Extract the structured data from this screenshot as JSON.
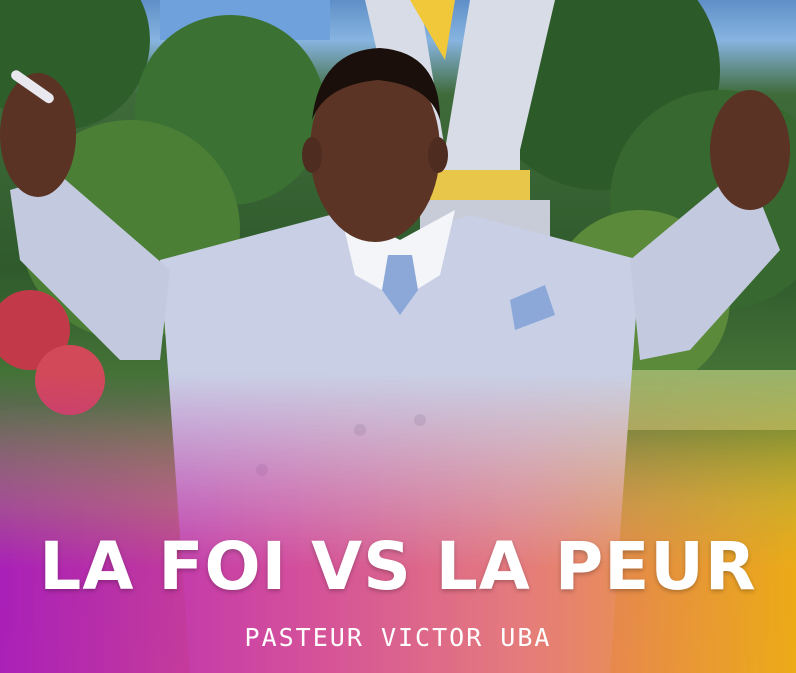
{
  "poster": {
    "title": "LA FOI VS LA PEUR",
    "subtitle": "PASTEUR VICTOR UBA"
  },
  "colors": {
    "gradient_left": "#a818be",
    "gradient_mid": "#e86e6e",
    "gradient_right": "#eeaa14",
    "suit": "#c9d0e6",
    "tie": "#8ba8d8"
  }
}
